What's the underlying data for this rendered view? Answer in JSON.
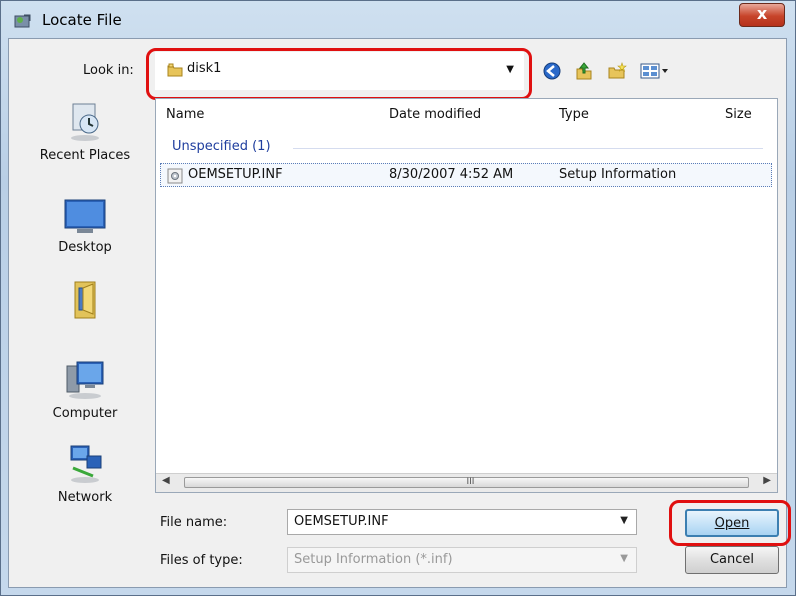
{
  "window": {
    "title": "Locate File",
    "close_label": "x"
  },
  "lookin": {
    "label": "Look in:",
    "value": "disk1"
  },
  "toolbar": {
    "icons": [
      "back-arrow-icon",
      "up-folder-icon",
      "new-folder-icon",
      "views-menu-icon"
    ]
  },
  "places": [
    {
      "label": "Recent Places",
      "icon": "recent-places-icon"
    },
    {
      "label": "Desktop",
      "icon": "desktop-icon"
    },
    {
      "label": "",
      "icon": "user-folder-icon"
    },
    {
      "label": "Computer",
      "icon": "computer-icon"
    },
    {
      "label": "Network",
      "icon": "network-icon"
    }
  ],
  "columns": {
    "name": "Name",
    "date": "Date modified",
    "type": "Type",
    "size": "Size"
  },
  "group": {
    "label": "Unspecified (1)"
  },
  "files": [
    {
      "name": "OEMSETUP.INF",
      "date": "8/30/2007 4:52 AM",
      "type": "Setup Information"
    }
  ],
  "scrollbar": {
    "grip": "III"
  },
  "filename": {
    "label": "File name:",
    "value": "OEMSETUP.INF"
  },
  "filetype": {
    "label": "Files of type:",
    "value": "Setup Information (*.inf)"
  },
  "buttons": {
    "open": "Open",
    "cancel": "Cancel"
  },
  "colors": {
    "highlight_ring": "#e01010",
    "group_text": "#1e3d9e"
  }
}
